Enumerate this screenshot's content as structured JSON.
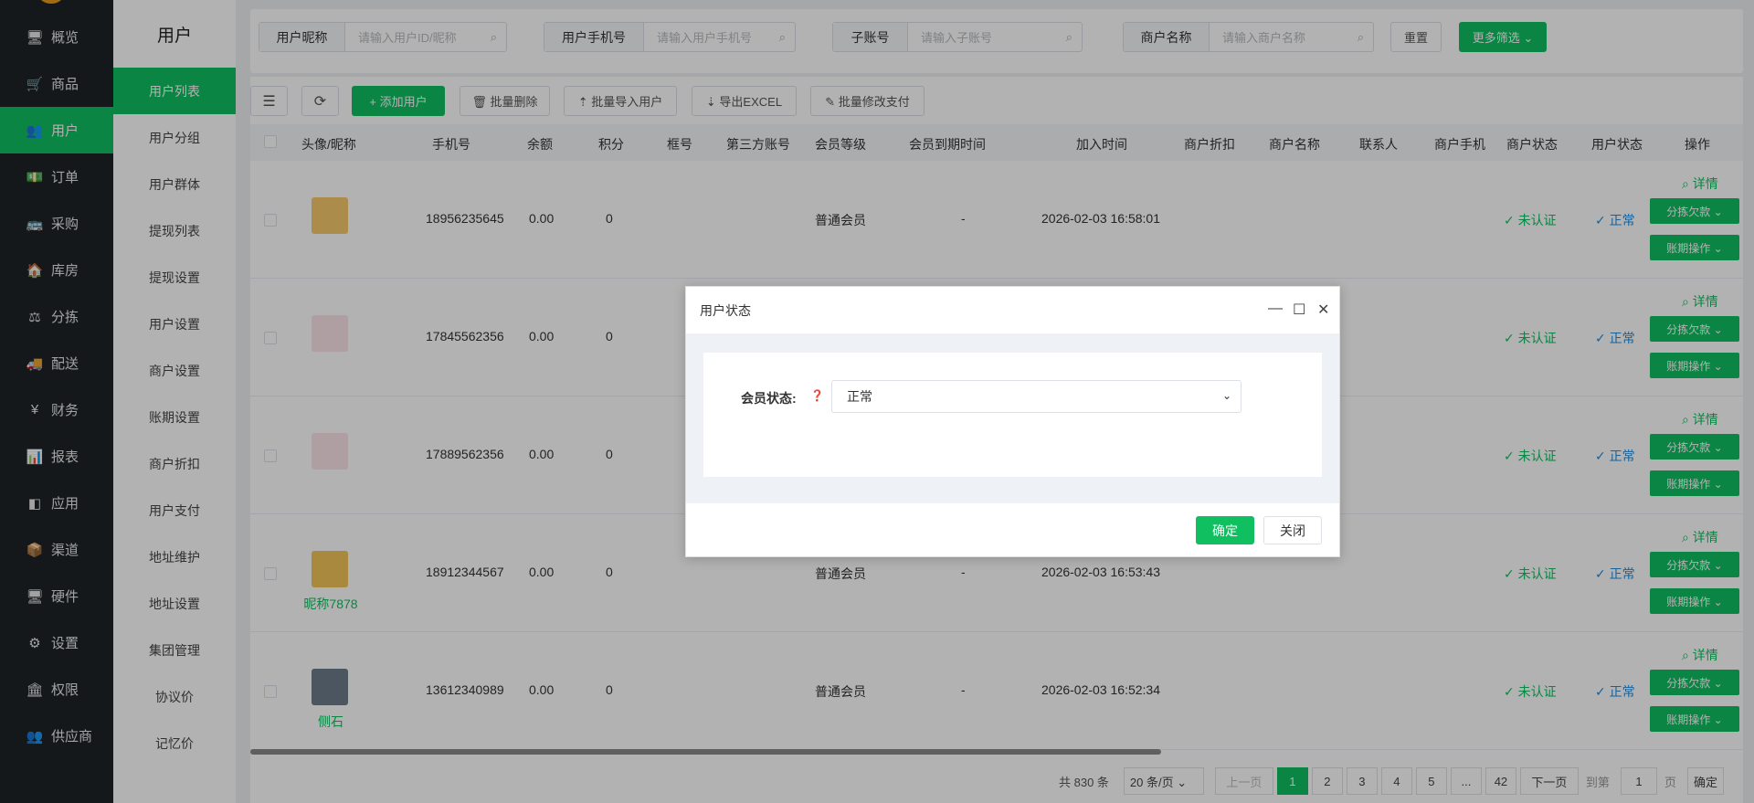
{
  "nav": {
    "items": [
      {
        "icon": "🖥",
        "label": "概览"
      },
      {
        "icon": "🛒",
        "label": "商品"
      },
      {
        "icon": "👥",
        "label": "用户"
      },
      {
        "icon": "💵",
        "label": "订单"
      },
      {
        "icon": "🚌",
        "label": "采购"
      },
      {
        "icon": "🏠",
        "label": "库房"
      },
      {
        "icon": "⚖",
        "label": "分拣"
      },
      {
        "icon": "🚚",
        "label": "配送"
      },
      {
        "icon": "¥",
        "label": "财务"
      },
      {
        "icon": "📊",
        "label": "报表"
      },
      {
        "icon": "◧",
        "label": "应用"
      },
      {
        "icon": "📦",
        "label": "渠道"
      },
      {
        "icon": "🖥",
        "label": "硬件"
      },
      {
        "icon": "⚙",
        "label": "设置"
      },
      {
        "icon": "🏛",
        "label": "权限"
      },
      {
        "icon": "👥",
        "label": "供应商"
      }
    ]
  },
  "sub": {
    "title": "用户",
    "items": [
      "用户列表",
      "用户分组",
      "用户群体",
      "提现列表",
      "提现设置",
      "用户设置",
      "商户设置",
      "账期设置",
      "商户折扣",
      "用户支付",
      "地址维护",
      "地址设置",
      "集团管理",
      "协议价",
      "记忆价"
    ]
  },
  "filters": {
    "nickname_label": "用户昵称",
    "nickname_placeholder": "请输入用户ID/昵称",
    "phone_label": "用户手机号",
    "phone_placeholder": "请输入用户手机号",
    "subaccount_label": "子账号",
    "subaccount_placeholder": "请输入子账号",
    "merchant_label": "商户名称",
    "merchant_placeholder": "请输入商户名称",
    "reset": "重置",
    "more": "更多筛选 ⌄"
  },
  "toolbar": {
    "add": "+ 添加用户",
    "batch_delete": "🗑 批量删除",
    "batch_import": "⇡ 批量导入用户",
    "export": "⇣ 导出EXCEL",
    "batch_pay": "✎ 批量修改支付"
  },
  "table": {
    "headers": [
      "头像/昵称",
      "手机号",
      "余额",
      "积分",
      "框号",
      "第三方账号",
      "会员等级",
      "会员到期时间",
      "加入时间",
      "商户折扣",
      "商户名称",
      "联系人",
      "商户手机",
      "商户状态",
      "用户状态",
      "操作"
    ],
    "rows": [
      {
        "nick": "",
        "phone": "18956235645",
        "balance": "0.00",
        "points": "0",
        "level": "普通会员",
        "expire": "-",
        "joined": "2026-02-03 16:58:01",
        "merchant_status": "✓ 未认证",
        "user_status": "✓ 正常"
      },
      {
        "nick": "",
        "phone": "17845562356",
        "balance": "0.00",
        "points": "0",
        "level": "",
        "expire": "",
        "joined": "",
        "merchant_status": "✓ 未认证",
        "user_status": "✓ 正常"
      },
      {
        "nick": "",
        "phone": "17889562356",
        "balance": "0.00",
        "points": "0",
        "level": "",
        "expire": "",
        "joined": "",
        "merchant_status": "✓ 未认证",
        "user_status": "✓ 正常"
      },
      {
        "nick": "昵称7878",
        "phone": "18912344567",
        "balance": "0.00",
        "points": "0",
        "level": "普通会员",
        "expire": "-",
        "joined": "2026-02-03 16:53:43",
        "merchant_status": "✓ 未认证",
        "user_status": "✓ 正常"
      },
      {
        "nick": "侧石",
        "phone": "13612340989",
        "balance": "0.00",
        "points": "0",
        "level": "普通会员",
        "expire": "-",
        "joined": "2026-02-03 16:52:34",
        "merchant_status": "✓ 未认证",
        "user_status": "✓ 正常"
      }
    ],
    "ops": {
      "detail": "⌕ 详情",
      "sort_debt": "分拣欠款 ⌄",
      "period_op": "账期操作 ⌄"
    }
  },
  "pager": {
    "total": "共 830 条",
    "page_size": "20 条/页 ⌄",
    "prev": "上一页",
    "pages": [
      "1",
      "2",
      "3",
      "4",
      "5",
      "...",
      "42"
    ],
    "next": "下一页",
    "goto": "到第",
    "goto_value": "1",
    "page_unit": "页",
    "confirm": "确定"
  },
  "modal": {
    "title": "用户状态",
    "field_label": "会员状态:",
    "help": "❓",
    "select_value": "正常",
    "ok": "确定",
    "close": "关闭"
  },
  "colors": {
    "accent": "#0fbf60",
    "link": "#1d8ce0",
    "nav_bg": "#1d2327"
  }
}
